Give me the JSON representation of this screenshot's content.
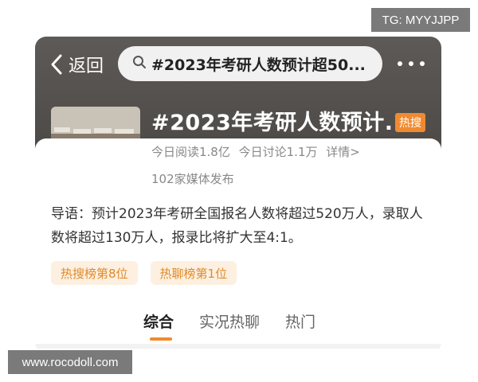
{
  "watermarks": {
    "top_right": "TG: MYYJJPP",
    "bottom_left": "www.rocodoll.com"
  },
  "nav": {
    "back_label": "返回",
    "search_text": "#2023年考研人数预计超50..."
  },
  "topic": {
    "title": "#2023年考研人数预计...",
    "hot_badge": "热搜",
    "stats": [
      "今日阅读1.8亿",
      "今日讨论1.1万",
      "详情>"
    ],
    "media": "102家媒体发布",
    "intro_label": "导语：",
    "intro_text": "预计2023年考研全国报名人数将超过520万人，录取人数将超过130万人，报录比将扩大至4:1。"
  },
  "tags": [
    "热搜榜第8位",
    "热聊榜第1位"
  ],
  "tabs": [
    {
      "label": "综合",
      "active": true
    },
    {
      "label": "实况热聊",
      "active": false
    },
    {
      "label": "热门",
      "active": false
    }
  ],
  "colors": {
    "accent": "#f08a30",
    "header_bg": "#555250",
    "tag_bg": "#fdf0e0",
    "tag_text": "#e08a2a"
  }
}
